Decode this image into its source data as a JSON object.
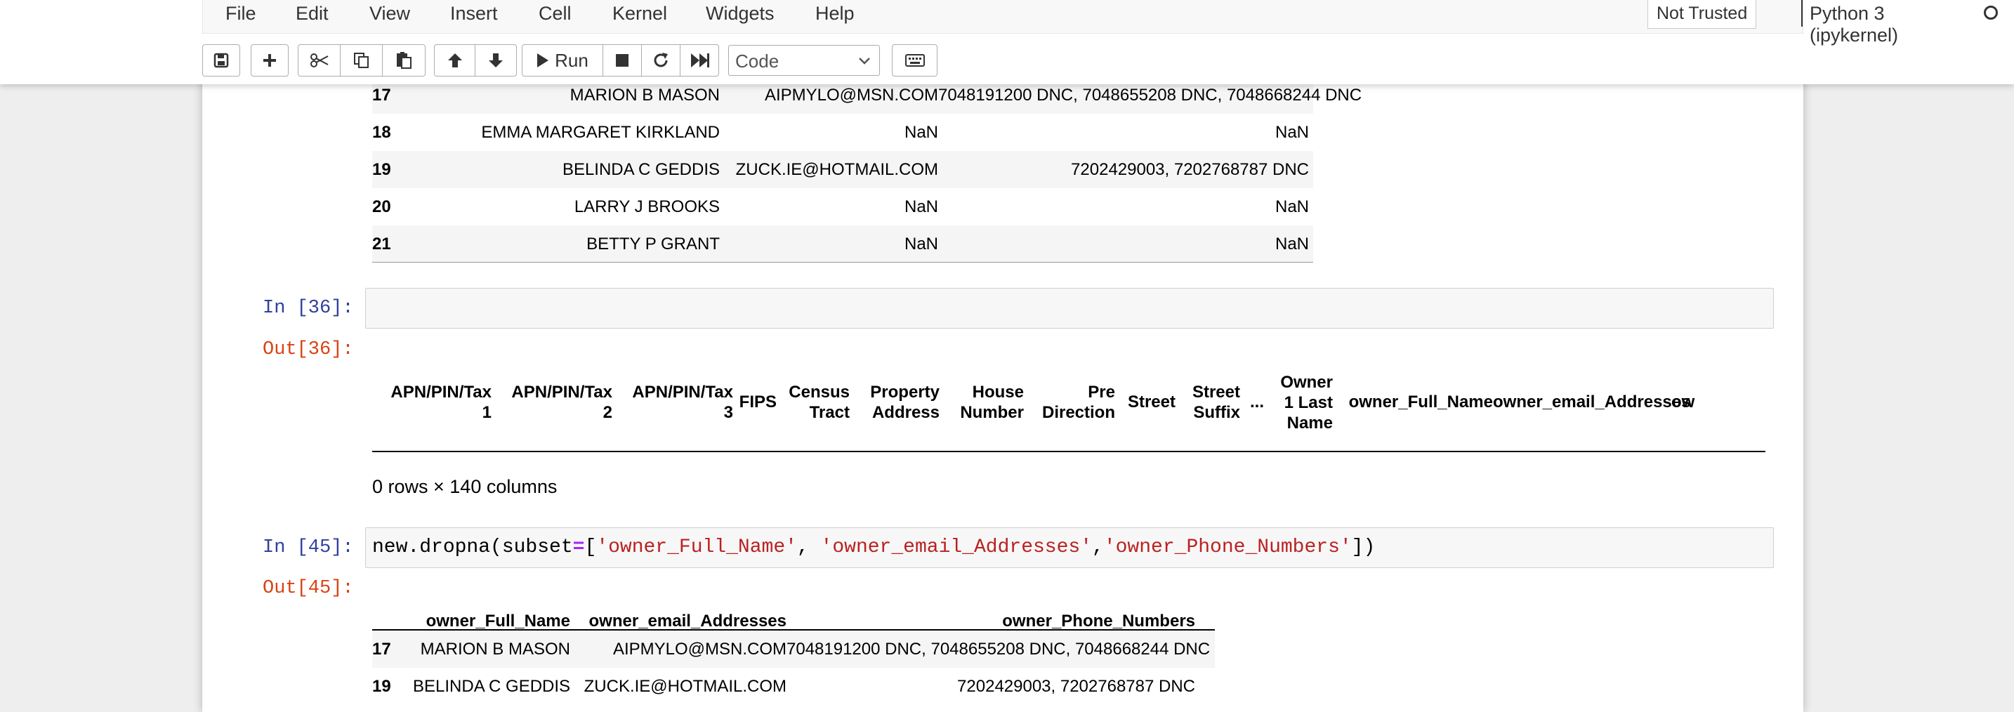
{
  "menu": {
    "items": [
      "File",
      "Edit",
      "View",
      "Insert",
      "Cell",
      "Kernel",
      "Widgets",
      "Help"
    ],
    "trust_status": "Not Trusted",
    "kernel_name": "Python 3 (ipykernel)"
  },
  "toolbar": {
    "buttons": [
      "save-icon",
      "plus-icon",
      "cut-icon",
      "copy-icon",
      "paste-icon",
      "arrow-up-icon",
      "arrow-down-icon",
      "run-icon",
      "stop-icon",
      "restart-icon",
      "fast-forward-icon",
      "keyboard-icon"
    ],
    "run_label": "Run",
    "cell_type": "Code"
  },
  "top_table": {
    "rows": [
      {
        "index": "17",
        "name": "MARION B MASON",
        "email": "AIPMYLO@MSN.COM",
        "phones": "7048191200 DNC, 7048655208 DNC, 7048668244 DNC"
      },
      {
        "index": "18",
        "name": "EMMA MARGARET KIRKLAND",
        "email": "NaN",
        "phones": "NaN"
      },
      {
        "index": "19",
        "name": "BELINDA C GEDDIS",
        "email": "ZUCK.IE@HOTMAIL.COM",
        "phones": "7202429003, 7202768787 DNC"
      },
      {
        "index": "20",
        "name": "LARRY J BROOKS",
        "email": "NaN",
        "phones": "NaN"
      },
      {
        "index": "21",
        "name": "BETTY P GRANT",
        "email": "NaN",
        "phones": "NaN"
      }
    ]
  },
  "cell36": {
    "in_prompt": "In [36]:",
    "out_prompt": "Out[36]:",
    "columns": [
      {
        "lines": [
          "APN/PIN/Tax",
          "1"
        ]
      },
      {
        "lines": [
          "APN/PIN/Tax",
          "2"
        ]
      },
      {
        "lines": [
          "APN/PIN/Tax",
          "3"
        ]
      },
      {
        "lines": [
          "FIPS"
        ]
      },
      {
        "lines": [
          "Census",
          "Tract"
        ]
      },
      {
        "lines": [
          "Property",
          "Address"
        ]
      },
      {
        "lines": [
          "House",
          "Number"
        ]
      },
      {
        "lines": [
          "Pre",
          "Direction"
        ]
      },
      {
        "lines": [
          "Street"
        ]
      },
      {
        "lines": [
          "Street",
          "Suffix"
        ]
      },
      {
        "lines": [
          "..."
        ]
      },
      {
        "lines": [
          "Owner",
          "1 Last",
          "Name"
        ]
      },
      {
        "lines": [
          "owner_Full_Name"
        ]
      },
      {
        "lines": [
          "owner_email_Addresses"
        ]
      },
      {
        "lines": [
          "ow"
        ]
      }
    ],
    "shape_text": "0 rows × 140 columns"
  },
  "cell45": {
    "in_prompt": "In [45]:",
    "out_prompt": "Out[45]:",
    "code": {
      "call": "new.dropna(subset",
      "eq": "=",
      "open": "[",
      "s1": "'owner_Full_Name'",
      "sep1": ", ",
      "s2": "'owner_email_Addresses'",
      "sep2": ",",
      "s3": "'owner_Phone_Numbers'",
      "close": "])"
    },
    "headers": [
      "owner_Full_Name",
      "owner_email_Addresses",
      "owner_Phone_Numbers"
    ],
    "rows": [
      {
        "index": "17",
        "name": "MARION B MASON",
        "email": "AIPMYLO@MSN.COM",
        "phones": "7048191200 DNC, 7048655208 DNC, 7048668244 DNC"
      },
      {
        "index": "19",
        "name": "BELINDA C GEDDIS",
        "email": "ZUCK.IE@HOTMAIL.COM",
        "phones": "7202429003, 7202768787 DNC"
      }
    ]
  }
}
